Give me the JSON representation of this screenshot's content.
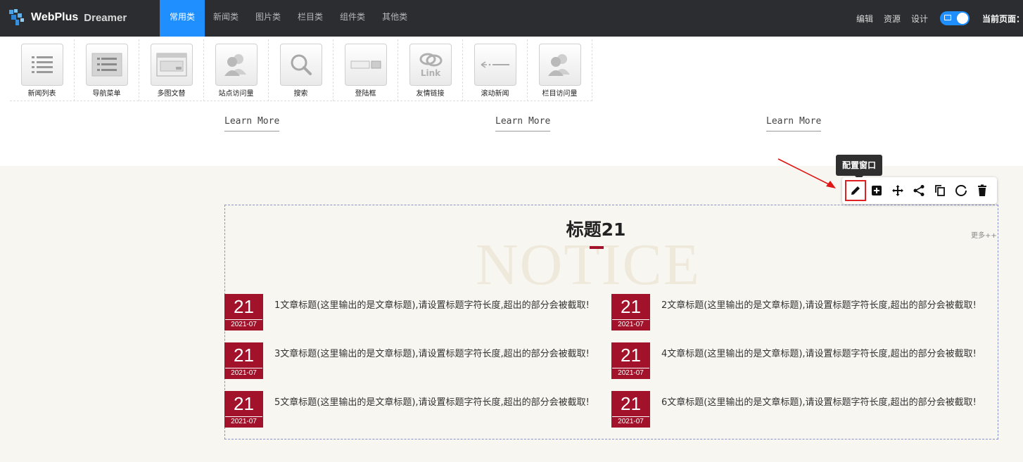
{
  "app": {
    "logo_text": "WebPlus",
    "logo_sub": "Dreamer"
  },
  "tabs": [
    {
      "label": "常用类",
      "active": true
    },
    {
      "label": "新闻类"
    },
    {
      "label": "图片类"
    },
    {
      "label": "栏目类"
    },
    {
      "label": "组件类"
    },
    {
      "label": "其他类"
    }
  ],
  "right_menu": {
    "edit": "编辑",
    "resources": "资源",
    "design": "设计",
    "current_page": "当前页面："
  },
  "widgets": [
    {
      "label": "新闻列表",
      "icon": "list-icon"
    },
    {
      "label": "导航菜单",
      "icon": "nav-menu-icon"
    },
    {
      "label": "多图文替",
      "icon": "multi-image-icon"
    },
    {
      "label": "站点访问量",
      "icon": "users-icon"
    },
    {
      "label": "搜索",
      "icon": "search-icon"
    },
    {
      "label": "登陆框",
      "icon": "login-box-icon"
    },
    {
      "label": "友情链接",
      "icon": "link-icon"
    },
    {
      "label": "滚动新闻",
      "icon": "scroll-news-icon"
    },
    {
      "label": "栏目访问量",
      "icon": "users-icon"
    }
  ],
  "learn_more": [
    "Learn More",
    "Learn More",
    "Learn More"
  ],
  "notice": {
    "bg_text": "NOTICE",
    "title": "标题21",
    "more": "更多++",
    "articles": [
      {
        "day": "21",
        "ym": "2021-07",
        "text": "1文章标题(这里输出的是文章标题),请设置标题字符长度,超出的部分会被截取!"
      },
      {
        "day": "21",
        "ym": "2021-07",
        "text": "2文章标题(这里输出的是文章标题),请设置标题字符长度,超出的部分会被截取!"
      },
      {
        "day": "21",
        "ym": "2021-07",
        "text": "3文章标题(这里输出的是文章标题),请设置标题字符长度,超出的部分会被截取!"
      },
      {
        "day": "21",
        "ym": "2021-07",
        "text": "4文章标题(这里输出的是文章标题),请设置标题字符长度,超出的部分会被截取!"
      },
      {
        "day": "21",
        "ym": "2021-07",
        "text": "5文章标题(这里输出的是文章标题),请设置标题字符长度,超出的部分会被截取!"
      },
      {
        "day": "21",
        "ym": "2021-07",
        "text": "6文章标题(这里输出的是文章标题),请设置标题字符长度,超出的部分会被截取!"
      }
    ]
  },
  "tooltip": "配置窗口",
  "toolbar": [
    "edit-pencil-icon",
    "add-box-icon",
    "move-icon",
    "share-icon",
    "copy-icon",
    "refresh-icon",
    "delete-icon"
  ],
  "colors": {
    "accent": "#1f8fff",
    "brand_red": "#a3122b",
    "topbar": "#2b2d30",
    "section_bg": "#f8f6f1"
  }
}
